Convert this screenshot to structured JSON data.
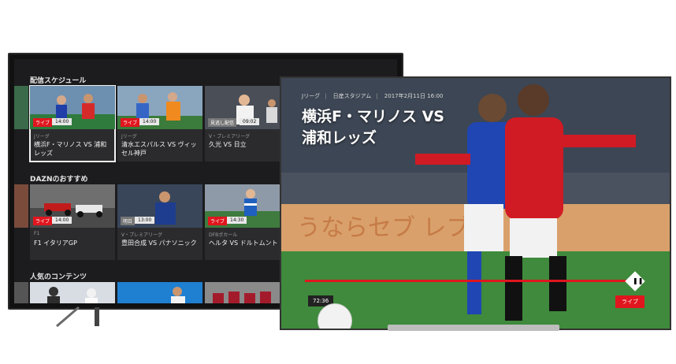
{
  "left_tv": {
    "sections": [
      {
        "title": "配信スケジュール",
        "cards": [
          {
            "badge": "ライブ",
            "time": "14:00",
            "category": "Jリーグ",
            "name": "横浜F・マリノス VS 浦和レッズ",
            "selected": true
          },
          {
            "badge": "ライブ",
            "time": "14:00",
            "category": "Jリーグ",
            "name": "清水エスパルス VS ヴィッセル神戸"
          },
          {
            "badge": "見逃し配信",
            "time": "09:02",
            "category": "V・プレミアリーグ",
            "name": "久光 VS 日立"
          }
        ]
      },
      {
        "title": "DAZNのおすすめ",
        "cards": [
          {
            "badge": "ライブ",
            "time": "14:00",
            "category": "F1",
            "name": "F1 イタリアGP"
          },
          {
            "badge": "明日",
            "time": "13:00",
            "category": "V・プレミアリーグ",
            "name": "豊田合成 VS パナソニック"
          },
          {
            "badge": "ライブ",
            "time": "14:30",
            "category": "DFBポカール",
            "name": "ヘルタ VS ドルトムント"
          }
        ]
      },
      {
        "title": "人気のコンテンツ",
        "cards": []
      }
    ]
  },
  "right_tv": {
    "breadcrumb": [
      "Jリーグ",
      "日産スタジアム",
      "2017年2月11日 16:00"
    ],
    "title_line1": "横浜F・マリノス VS",
    "title_line2": "浦和レッズ",
    "elapsed": "72:36",
    "live_label": "ライブ",
    "progress": 0.96
  },
  "colors": {
    "accent": "#e0161e",
    "bg": "#1c1c1e"
  }
}
